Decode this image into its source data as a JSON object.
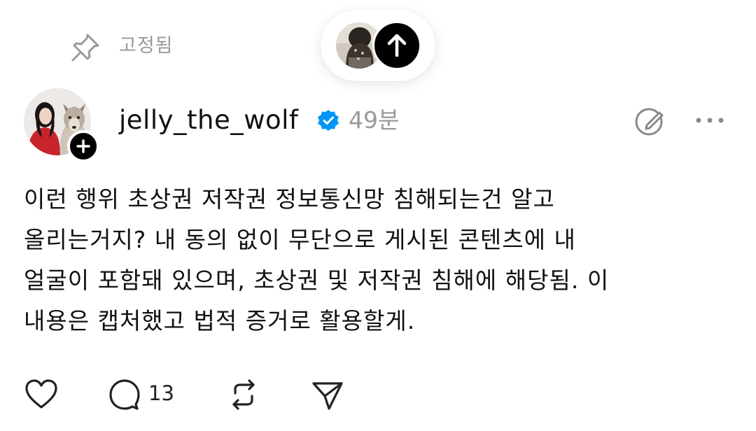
{
  "pinned": {
    "label": "고정됨",
    "icon": "pin-icon"
  },
  "scroll_top": {
    "icon": "arrow-up-icon"
  },
  "author": {
    "username": "jelly_the_wolf",
    "time": "49분",
    "verified": true,
    "verified_color": "#0095F6"
  },
  "post": {
    "text": "이런 행위 초상권 저작권 정보통신망 침해되는건 알고\n올리는거지? 내 동의 없이 무단으로 게시된 콘텐츠에 내\n얼굴이 포함돼 있으며, 초상권 및 저작권 침해에 해당됨. 이\n내용은 캡처했고 법적 증거로 활용할게."
  },
  "actions": {
    "reply_count": "13",
    "icons": [
      "heart-icon",
      "comment-icon",
      "repost-icon",
      "send-icon"
    ]
  },
  "colors": {
    "muted_text": "#999999",
    "text": "#111111",
    "accent_dark": "#000000"
  }
}
